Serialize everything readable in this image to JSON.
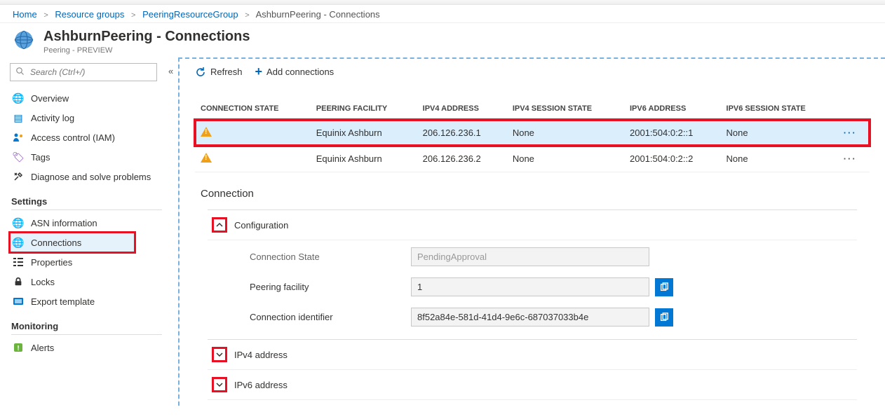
{
  "breadcrumb": {
    "home": "Home",
    "rg": "Resource groups",
    "group": "PeeringResourceGroup",
    "current": "AshburnPeering - Connections"
  },
  "header": {
    "title": "AshburnPeering - Connections",
    "sub": "Peering - PREVIEW"
  },
  "search": {
    "placeholder": "Search (Ctrl+/)"
  },
  "nav": {
    "overview": "Overview",
    "activity": "Activity log",
    "iam": "Access control (IAM)",
    "tags": "Tags",
    "diag": "Diagnose and solve problems",
    "settings": "Settings",
    "asn": "ASN information",
    "conn": "Connections",
    "props": "Properties",
    "locks": "Locks",
    "export": "Export template",
    "monitoring": "Monitoring",
    "alerts": "Alerts"
  },
  "toolbar": {
    "refresh": "Refresh",
    "add": "Add connections"
  },
  "table": {
    "headers": {
      "state": "CONNECTION STATE",
      "facility": "PEERING FACILITY",
      "ipv4": "IPV4 ADDRESS",
      "ipv4s": "IPV4 SESSION STATE",
      "ipv6": "IPV6 ADDRESS",
      "ipv6s": "IPV6 SESSION STATE"
    },
    "r1": {
      "facility": "Equinix Ashburn",
      "ipv4": "206.126.236.1",
      "ipv4s": "None",
      "ipv6": "2001:504:0:2::1",
      "ipv6s": "None"
    },
    "r2": {
      "facility": "Equinix Ashburn",
      "ipv4": "206.126.236.2",
      "ipv4s": "None",
      "ipv6": "2001:504:0:2::2",
      "ipv6s": "None"
    }
  },
  "detail": {
    "section": "Connection",
    "config": "Configuration",
    "conn_state_label": "Connection State",
    "conn_state_value": "PendingApproval",
    "facility_label": "Peering facility",
    "facility_value": "1",
    "connid_label": "Connection identifier",
    "connid_value": "8f52a84e-581d-41d4-9e6c-687037033b4e",
    "ipv4": "IPv4 address",
    "ipv6": "IPv6 address"
  }
}
